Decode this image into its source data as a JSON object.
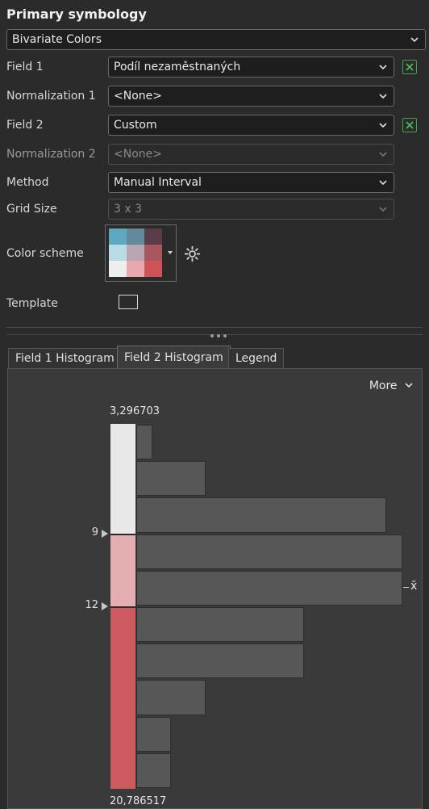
{
  "header": {
    "title": "Primary symbology"
  },
  "renderer": {
    "value": "Bivariate Colors"
  },
  "fields": {
    "field1_label": "Field 1",
    "field1_value": "Podíl nezaměstnaných",
    "norm1_label": "Normalization 1",
    "norm1_value": "<None>",
    "field2_label": "Field 2",
    "field2_value": "Custom",
    "norm2_label": "Normalization 2",
    "norm2_value": "<None>",
    "method_label": "Method",
    "method_value": "Manual Interval",
    "grid_label": "Grid Size",
    "grid_value": "3 x 3",
    "scheme_label": "Color scheme",
    "template_label": "Template"
  },
  "scheme_colors": [
    [
      "#5fa9c0",
      "#628a9b",
      "#5b3d49"
    ],
    [
      "#b8dce6",
      "#b9a6b2",
      "#a8565f"
    ],
    [
      "#eeeeee",
      "#e9a9ac",
      "#cf5257"
    ]
  ],
  "tabs": [
    {
      "label": "Field 1 Histogram",
      "active": false
    },
    {
      "label": "Field 2 Histogram",
      "active": true
    },
    {
      "label": "Legend",
      "active": false
    }
  ],
  "histogram": {
    "more_label": "More",
    "top_value": "3,296703",
    "bottom_value": "20,786517",
    "breaks": [
      "9",
      "12"
    ],
    "mean_label": "x̄",
    "class_colors": [
      "#e8e8e8",
      "#e4aeb1",
      "#cd5a5e"
    ],
    "bins": [
      0.06,
      0.26,
      0.94,
      1.0,
      1.0,
      0.63,
      0.63,
      0.26,
      0.13,
      0.13
    ]
  }
}
